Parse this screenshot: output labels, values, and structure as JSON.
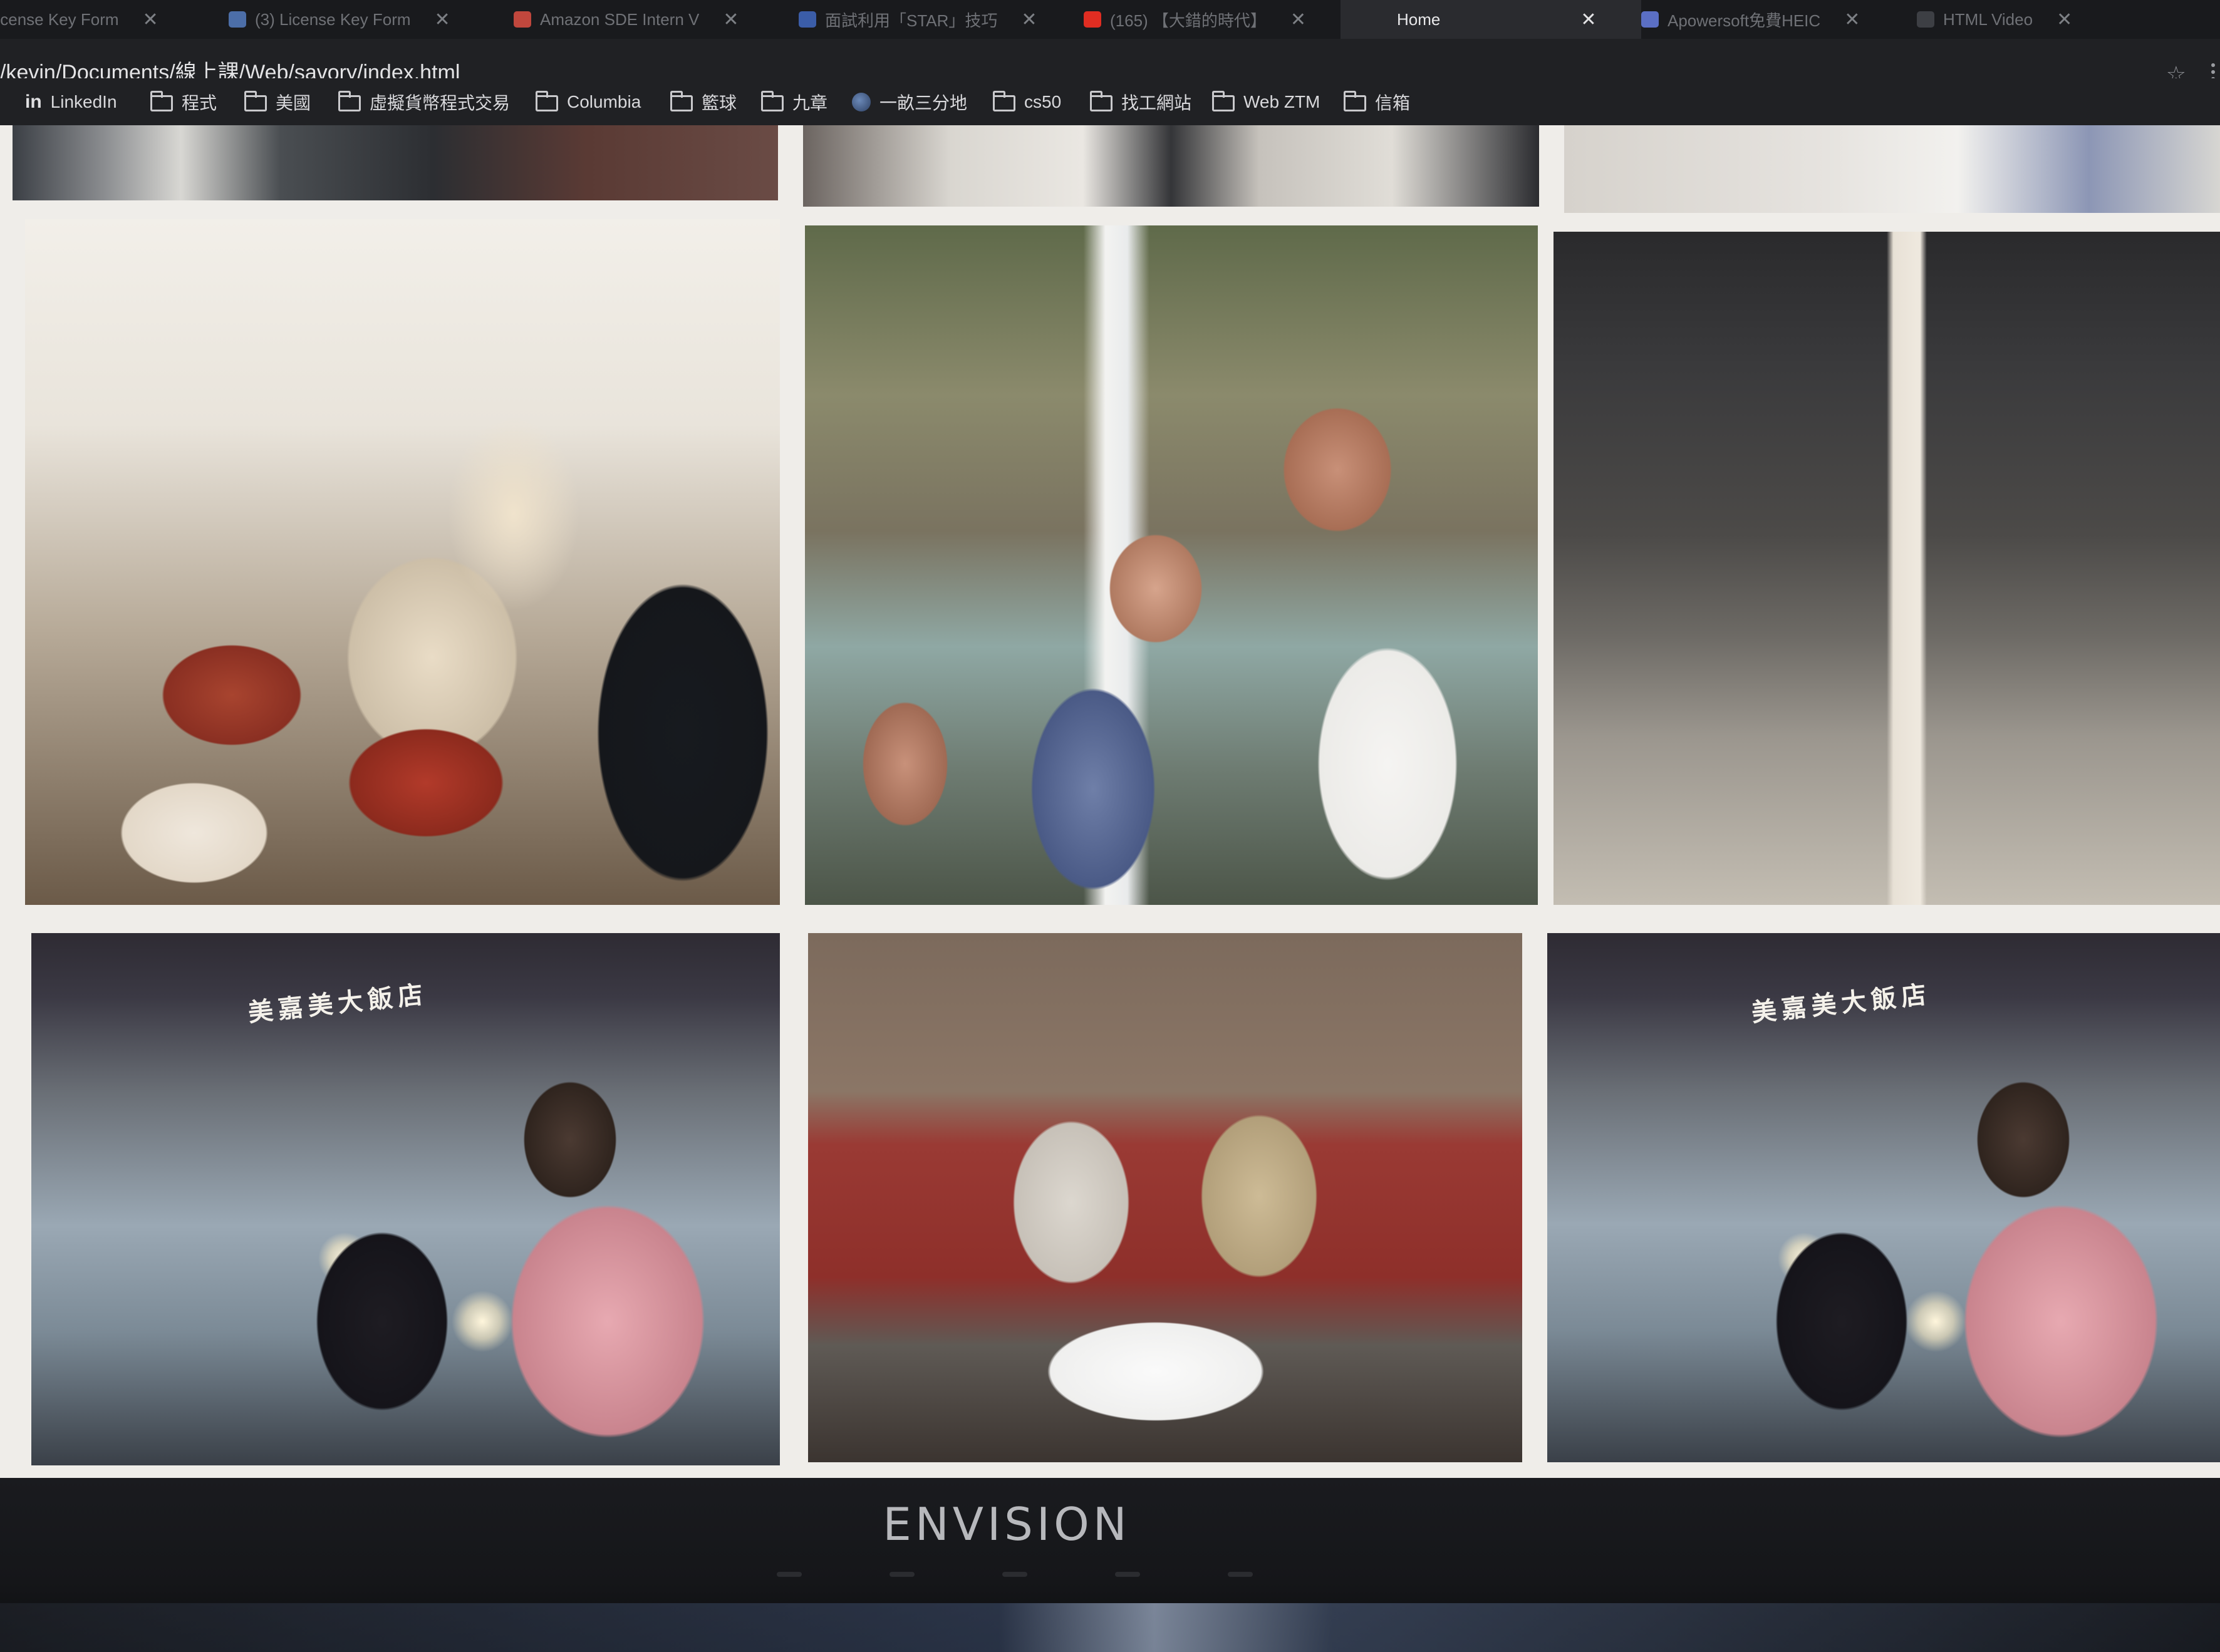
{
  "browser": {
    "tabs": [
      {
        "label": "License Key Form",
        "favicon": "form-favicon",
        "active": false
      },
      {
        "label": "(3) License Key Form",
        "favicon": "form-favicon",
        "active": false
      },
      {
        "label": "Amazon SDE Intern V",
        "favicon": "mail-favicon",
        "active": false
      },
      {
        "label": "面試利用「STAR」技巧",
        "favicon": "page-favicon",
        "active": false
      },
      {
        "label": "(165) 【大錯的時代】",
        "favicon": "youtube-favicon",
        "active": false
      },
      {
        "label": "Home",
        "favicon": "",
        "active": true
      },
      {
        "label": "Apowersoft免費HEIC",
        "favicon": "page-favicon",
        "active": false
      },
      {
        "label": "HTML Video",
        "favicon": "w3-favicon",
        "active": false
      }
    ],
    "url": "/kevin/Documents/線上課/Web/savory/index.html",
    "bookmarks": [
      {
        "label": "LinkedIn",
        "icon": "linkedin-icon"
      },
      {
        "label": "程式",
        "icon": "folder-icon"
      },
      {
        "label": "美國",
        "icon": "folder-icon"
      },
      {
        "label": "虛擬貨幣程式交易",
        "icon": "folder-icon"
      },
      {
        "label": "Columbia",
        "icon": "folder-icon"
      },
      {
        "label": "籃球",
        "icon": "folder-icon"
      },
      {
        "label": "九章",
        "icon": "folder-icon"
      },
      {
        "label": "一畝三分地",
        "icon": "globe-icon"
      },
      {
        "label": "cs50",
        "icon": "folder-icon"
      },
      {
        "label": "找工網站",
        "icon": "folder-icon"
      },
      {
        "label": "Web ZTM",
        "icon": "folder-icon"
      },
      {
        "label": "信箱",
        "icon": "folder-icon"
      }
    ]
  },
  "gallery": {
    "sign_text": "美嘉美大飯店"
  },
  "monitor": {
    "brand": "ENVISION"
  },
  "colors": {
    "tabbar": "#191a1d",
    "toolbar": "#202124",
    "page_background": "#efede9"
  }
}
